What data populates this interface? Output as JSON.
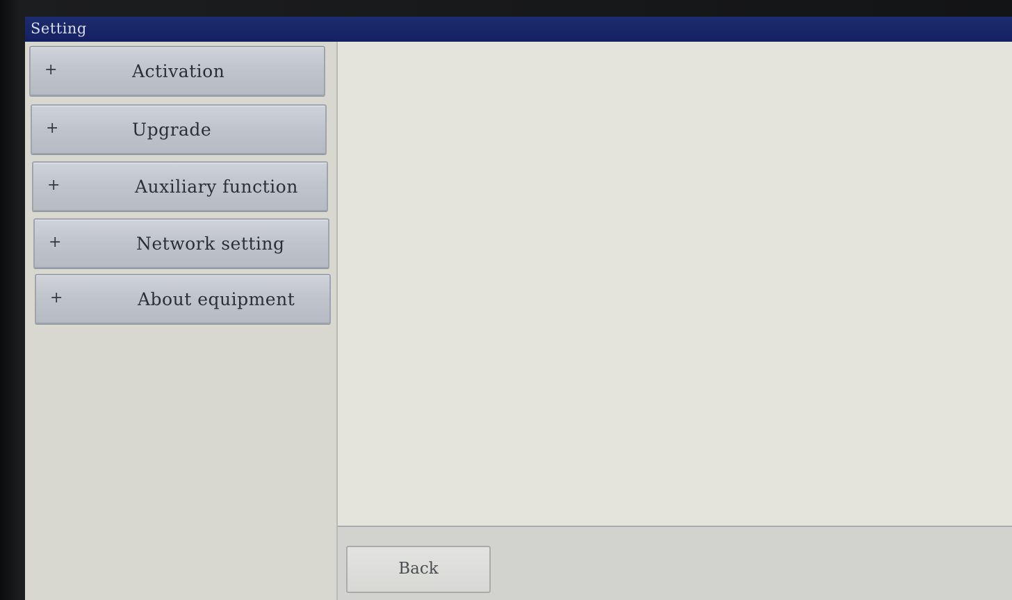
{
  "window": {
    "title": "Setting"
  },
  "sidebar": {
    "items": [
      {
        "icon": "plus-icon",
        "symbol": "+",
        "label": "Activation"
      },
      {
        "icon": "plus-icon",
        "symbol": "+",
        "label": "Upgrade"
      },
      {
        "icon": "plus-icon",
        "symbol": "+",
        "label": "Auxiliary function"
      },
      {
        "icon": "plus-icon",
        "symbol": "+",
        "label": "Network setting"
      },
      {
        "icon": "plus-icon",
        "symbol": "+",
        "label": "About equipment"
      }
    ]
  },
  "footer": {
    "back_label": "Back"
  },
  "colors": {
    "title_bar": "#142062",
    "title_text": "#d9dcef",
    "menu_button": "#bfc4cb",
    "panel_background": "#e4e3dc"
  }
}
